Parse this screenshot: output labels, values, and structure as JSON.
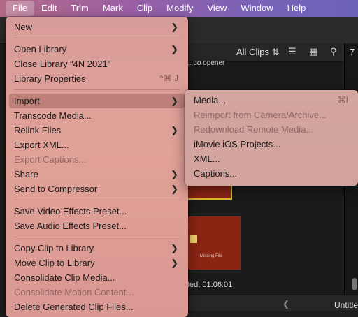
{
  "menubar": {
    "items": [
      "File",
      "Edit",
      "Trim",
      "Mark",
      "Clip",
      "Modify",
      "View",
      "Window",
      "Help"
    ]
  },
  "browser": {
    "filter_label": "All Clips",
    "clip_caption": "...go opener",
    "missing_file_label": "Missing File",
    "status_text": "ted, 01:06:01",
    "right_top": "7",
    "timeline_title": "Untitle"
  },
  "file_menu": {
    "groups": [
      [
        {
          "label": "New",
          "submenu": true
        }
      ],
      [
        {
          "label": "Open Library",
          "submenu": true
        },
        {
          "label": "Close Library “4N 2021”"
        },
        {
          "label": "Library Properties",
          "shortcut": "^⌘ J"
        }
      ],
      [
        {
          "label": "Import",
          "submenu": true,
          "highlighted": true
        },
        {
          "label": "Transcode Media..."
        },
        {
          "label": "Relink Files",
          "submenu": true
        },
        {
          "label": "Export XML..."
        },
        {
          "label": "Export Captions...",
          "disabled": true
        },
        {
          "label": "Share",
          "submenu": true
        },
        {
          "label": "Send to Compressor",
          "submenu": true
        }
      ],
      [
        {
          "label": "Save Video Effects Preset..."
        },
        {
          "label": "Save Audio Effects Preset..."
        }
      ],
      [
        {
          "label": "Copy Clip to Library",
          "submenu": true
        },
        {
          "label": "Move Clip to Library",
          "submenu": true
        },
        {
          "label": "Consolidate Clip Media..."
        },
        {
          "label": "Consolidate Motion Content...",
          "disabled": true
        },
        {
          "label": "Delete Generated Clip Files..."
        }
      ]
    ]
  },
  "import_submenu": {
    "items": [
      {
        "label": "Media...",
        "shortcut": "⌘I"
      },
      {
        "label": "Reimport from Camera/Archive...",
        "disabled": true
      },
      {
        "label": "Redownload Remote Media...",
        "disabled": true
      },
      {
        "label": "iMovie iOS Projects..."
      },
      {
        "label": "XML..."
      },
      {
        "label": "Captions..."
      }
    ]
  },
  "icons": {
    "submenu_arrow": "chevron-right-icon",
    "filter_arrows": "up-down-chevron-icon",
    "list_view": "list-view-icon",
    "filmstrip": "filmstrip-icon",
    "search": "search-icon"
  }
}
